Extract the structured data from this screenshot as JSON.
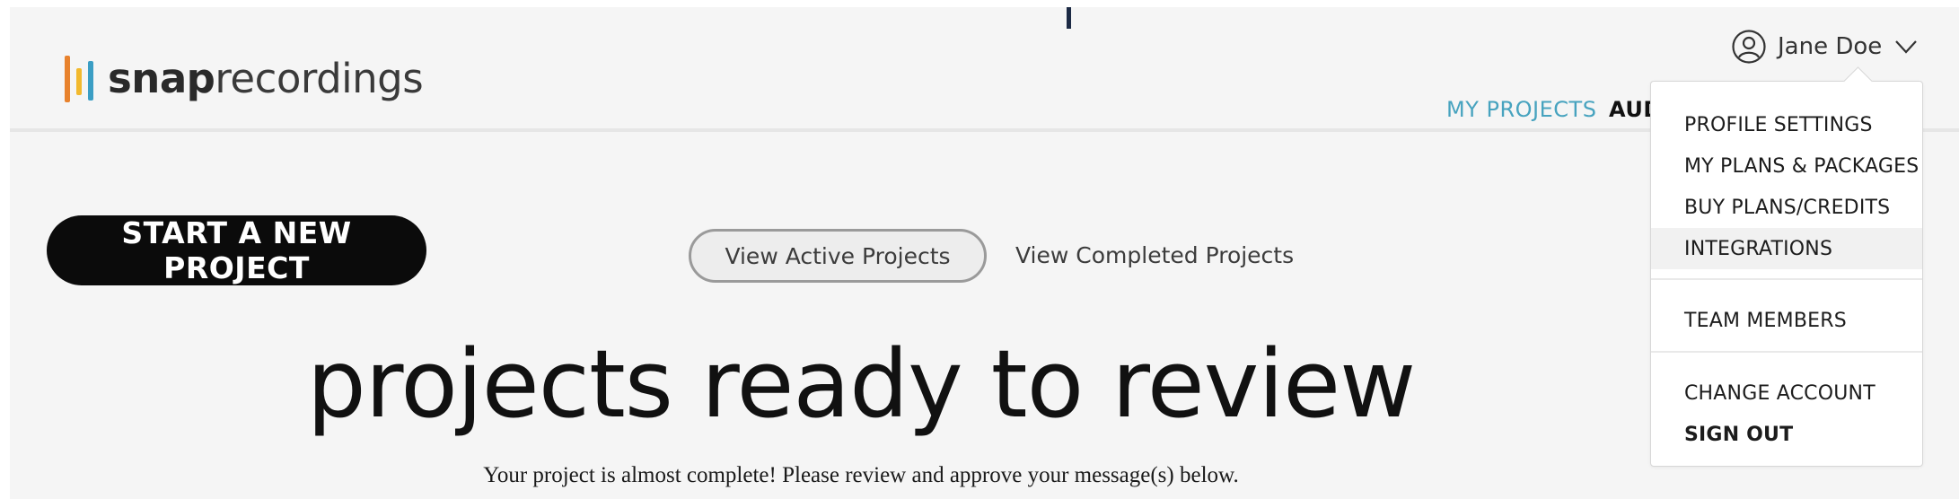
{
  "logo": {
    "bold": "snap",
    "light": "recordings"
  },
  "user": {
    "name": "Jane Doe"
  },
  "nav": {
    "my_projects": "MY PROJECTS",
    "audio": "AUDIO"
  },
  "main": {
    "start_button": "START A NEW PROJECT",
    "tabs": {
      "active": "View Active Projects",
      "completed": "View Completed Projects"
    },
    "title": "projects ready to review",
    "subtitle": "Your project is almost complete! Please review and approve your message(s) below."
  },
  "dropdown": {
    "items": [
      {
        "label": "PROFILE SETTINGS"
      },
      {
        "label": "MY PLANS & PACKAGES"
      },
      {
        "label": "BUY PLANS/CREDITS"
      },
      {
        "label": "INTEGRATIONS"
      },
      {
        "label": "TEAM MEMBERS"
      },
      {
        "label": "CHANGE ACCOUNT"
      },
      {
        "label": "SIGN OUT"
      }
    ]
  },
  "colors": {
    "accent": "#47a3bf",
    "logo_orange": "#e8822d",
    "logo_yellow": "#f2b92e",
    "logo_blue": "#3b9ec4",
    "button_bg": "#0b0b0b"
  },
  "icons": {
    "user": "user-circle-icon",
    "menu": "chevron-down-icon"
  }
}
